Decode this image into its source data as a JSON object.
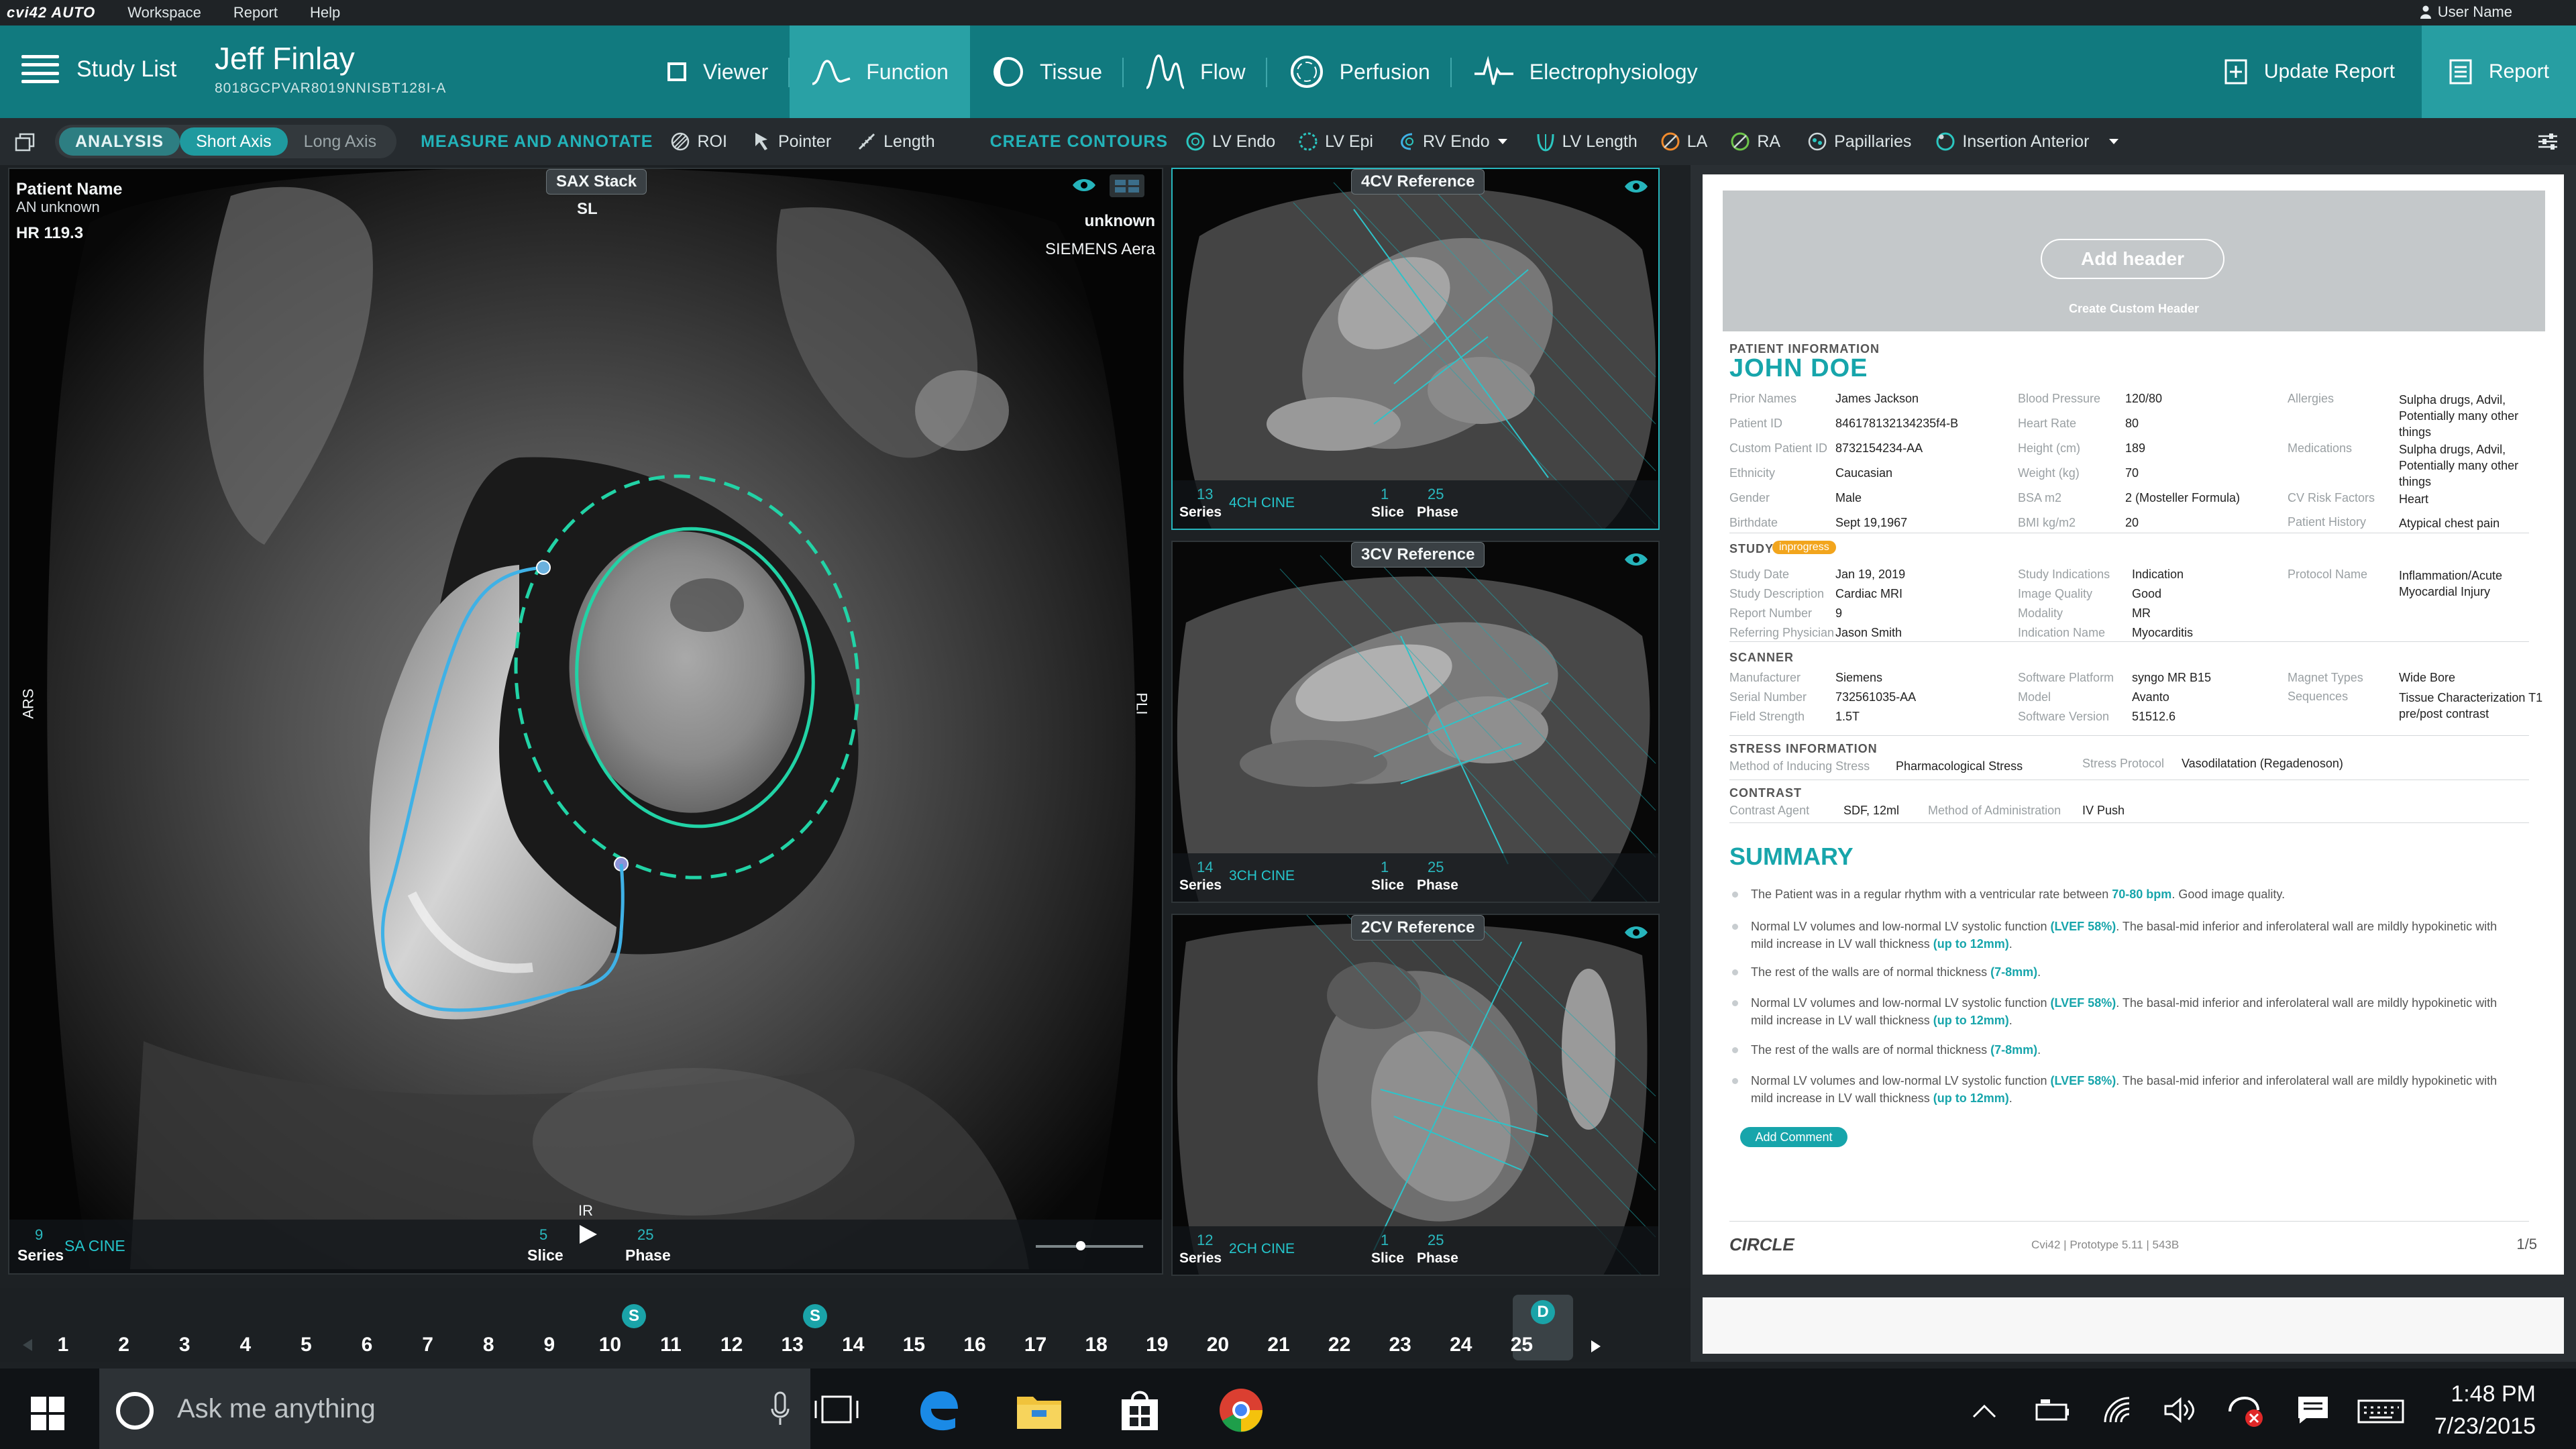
{
  "menubar": {
    "logo": "cvi42 AUTO",
    "items": [
      "Workspace",
      "Report",
      "Help"
    ],
    "user": "User Name"
  },
  "toolbar": {
    "study_list": "Study List",
    "patient_name": "Jeff Finlay",
    "patient_id": "8018GCPVAR8019NNISBT128I-A",
    "tabs": [
      "Viewer",
      "Function",
      "Tissue",
      "Flow",
      "Perfusion",
      "Electrophysiology"
    ],
    "active_tab": "Function",
    "update_report": "Update Report",
    "report": "Report"
  },
  "subbar": {
    "analysis": "ANALYSIS",
    "short_axis": "Short Axis",
    "long_axis": "Long Axis",
    "measure_label": "MEASURE AND ANNOTATE",
    "measure_items": [
      "ROI",
      "Pointer",
      "Length"
    ],
    "contours_label": "CREATE CONTOURS",
    "contour_items": [
      "LV Endo",
      "LV Epi",
      "RV Endo",
      "LV Length",
      "LA",
      "RA",
      "Papillaries",
      "Insertion Anterior"
    ]
  },
  "main_view": {
    "patient_label": "Patient Name",
    "patient_value": "AN unknown",
    "hr": "HR 119.3",
    "stack_tag": "SAX Stack",
    "stack_sub": "SL",
    "right_text1": "unknown",
    "right_text2": "SIEMENS Aera",
    "left_orient": "ARS",
    "right_orient": "PLI",
    "bottom_orient": "IR",
    "series_num": "9",
    "series_label": "Series",
    "series_name": "SA CINE",
    "slice_num": "5",
    "slice_label": "Slice",
    "phase_num": "25",
    "phase_label": "Phase"
  },
  "ref_views": [
    {
      "tag": "4CV Reference",
      "series_num": "13",
      "series_label": "Series",
      "series_name": "4CH CINE",
      "slice_num": "1",
      "slice_label": "Slice",
      "phase_num": "25",
      "phase_label": "Phase"
    },
    {
      "tag": "3CV Reference",
      "series_num": "14",
      "series_label": "Series",
      "series_name": "3CH CINE",
      "slice_num": "1",
      "slice_label": "Slice",
      "phase_num": "25",
      "phase_label": "Phase"
    },
    {
      "tag": "2CV Reference",
      "series_num": "12",
      "series_label": "Series",
      "series_name": "2CH CINE",
      "slice_num": "1",
      "slice_label": "Slice",
      "phase_num": "25",
      "phase_label": "Phase"
    }
  ],
  "timeline": {
    "phases": [
      "1",
      "2",
      "3",
      "4",
      "5",
      "6",
      "7",
      "8",
      "9",
      "10",
      "11",
      "12",
      "13",
      "14",
      "15",
      "16",
      "17",
      "18",
      "19",
      "20",
      "21",
      "22",
      "23",
      "24",
      "25"
    ],
    "badge_s1": "S",
    "badge_s2": "S",
    "badge_d": "D"
  },
  "report": {
    "add_header": "Add header",
    "create_custom_header": "Create Custom Header",
    "patient_info_title": "PATIENT INFORMATION",
    "patient_name": "JOHN DOE",
    "col1": [
      {
        "k": "Prior Names",
        "v": "James Jackson"
      },
      {
        "k": "Patient ID",
        "v": "846178132134235f4-B"
      },
      {
        "k": "Custom Patient ID",
        "v": "8732154234-AA"
      },
      {
        "k": "Ethnicity",
        "v": "Caucasian"
      },
      {
        "k": "Gender",
        "v": "Male"
      },
      {
        "k": "Birthdate",
        "v": "Sept 19,1967"
      }
    ],
    "col2": [
      {
        "k": "Blood Pressure",
        "v": "120/80"
      },
      {
        "k": "Heart Rate",
        "v": "80"
      },
      {
        "k": "Height (cm)",
        "v": "189"
      },
      {
        "k": "Weight (kg)",
        "v": "70"
      },
      {
        "k": "BSA m2",
        "v": "2 (Mosteller Formula)"
      },
      {
        "k": "BMI kg/m2",
        "v": "20"
      }
    ],
    "col3": [
      {
        "k": "Allergies",
        "v": "Sulpha drugs, Advil, Potentially many other things"
      },
      {
        "k": "Medications",
        "v": "Sulpha drugs, Advil, Potentially many other things"
      },
      {
        "k": "CV Risk Factors",
        "v": "Heart"
      },
      {
        "k": "Patient History",
        "v": "Atypical chest pain"
      }
    ],
    "study_title": "STUDY",
    "study_badge": "inprogress",
    "study1": [
      {
        "k": "Study Date",
        "v": "Jan 19, 2019"
      },
      {
        "k": "Study Description",
        "v": "Cardiac MRI"
      },
      {
        "k": "Report Number",
        "v": "9"
      },
      {
        "k": "Referring Physician",
        "v": "Jason Smith"
      }
    ],
    "study2": [
      {
        "k": "Study Indications",
        "v": "Indication"
      },
      {
        "k": "Image Quality",
        "v": "Good"
      },
      {
        "k": "Modality",
        "v": "MR"
      },
      {
        "k": "Indication Name",
        "v": "Myocarditis"
      }
    ],
    "study3": {
      "k": "Protocol Name",
      "v": "Inflammation/Acute Myocardial Injury"
    },
    "scanner_title": "SCANNER",
    "scanner1": [
      {
        "k": "Manufacturer",
        "v": "Siemens"
      },
      {
        "k": "Serial Number",
        "v": "732561035-AA"
      },
      {
        "k": "Field Strength",
        "v": "1.5T"
      }
    ],
    "scanner2": [
      {
        "k": "Software Platform",
        "v": "syngo MR B15"
      },
      {
        "k": "Model",
        "v": "Avanto"
      },
      {
        "k": "Software Version",
        "v": "51512.6"
      }
    ],
    "scanner3": [
      {
        "k": "Magnet Types",
        "v": "Wide Bore"
      },
      {
        "k": "Sequences",
        "v": "Tissue Characterization T1 pre/post contrast"
      }
    ],
    "stress_title": "STRESS INFORMATION",
    "stress_k1": "Method of Inducing Stress",
    "stress_v1": "Pharmacological Stress",
    "stress_k2": "Stress Protocol",
    "stress_v2": "Vasodilatation (Regadenoson)",
    "contrast_title": "CONTRAST",
    "contrast_k1": "Contrast Agent",
    "contrast_v1": "SDF, 12ml",
    "contrast_k2": "Method of Administration",
    "contrast_v2": "IV Push",
    "summary_title": "SUMMARY",
    "summary": [
      {
        "pre": "The Patient was in a regular rhythm with a ventricular rate between ",
        "b1": "70-80 bpm",
        "mid": ". Good image quality.",
        "b2": "",
        "post": ""
      },
      {
        "pre": "Normal LV volumes and low-normal LV systolic function ",
        "b1": "(LVEF 58%)",
        "mid": ". The basal-mid inferior and inferolateral wall are mildly hypokinetic with mild increase in LV wall thickness ",
        "b2": "(up to 12mm)",
        "post": "."
      },
      {
        "pre": "The rest of the walls are of normal thickness ",
        "b1": "(7-8mm)",
        "mid": ".",
        "b2": "",
        "post": ""
      },
      {
        "pre": "Normal LV volumes and low-normal LV systolic function ",
        "b1": "(LVEF 58%)",
        "mid": ". The basal-mid inferior and inferolateral wall are mildly hypokinetic with mild increase in LV wall thickness ",
        "b2": "(up to 12mm)",
        "post": "."
      },
      {
        "pre": "The rest of the walls are of normal thickness ",
        "b1": "(7-8mm)",
        "mid": ".",
        "b2": "",
        "post": ""
      },
      {
        "pre": "Normal LV volumes and low-normal LV systolic function ",
        "b1": "(LVEF 58%)",
        "mid": ". The basal-mid inferior and inferolateral wall are mildly hypokinetic with mild increase in LV wall thickness ",
        "b2": "(up to 12mm)",
        "post": "."
      }
    ],
    "add_comment": "Add Comment",
    "footer_logo": "CIRCLE",
    "footer_center": "Cvi42 | Prototype 5.11 | 543B",
    "footer_page": "1/5"
  },
  "taskbar": {
    "search_placeholder": "Ask me anything",
    "time": "1:48 PM",
    "date": "7/23/2015"
  },
  "colors": {
    "accent": "#117a7f",
    "accent_light": "#29a1a5",
    "contour_green": "#22d3a6",
    "contour_blue": "#3fb1e6",
    "report_teal": "#17a5ab"
  }
}
